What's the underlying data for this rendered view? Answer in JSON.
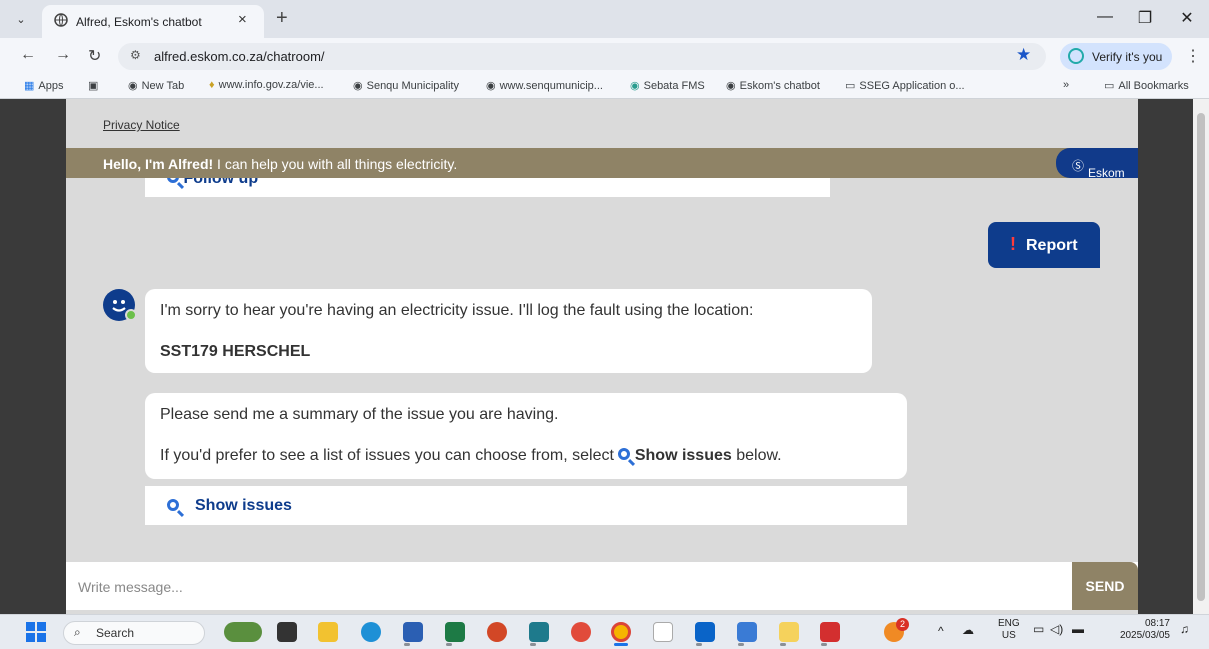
{
  "browser": {
    "tab_title": "Alfred, Eskom's chatbot",
    "tab_close": "×",
    "new_tab": "+",
    "url": "alfred.eskom.co.za/chatroom/",
    "verify_label": "Verify it's you",
    "window_minimize": "—",
    "window_restore": "❐",
    "window_close": "✕"
  },
  "bookmarks": {
    "apps": "Apps",
    "items": [
      "New Tab",
      "www.info.gov.za/vie...",
      "Senqu Municipality",
      "www.senqumunicip...",
      "Sebata FMS",
      "Eskom's chatbot",
      "SSEG Application o..."
    ],
    "more": "»",
    "all_bookmarks": "All Bookmarks"
  },
  "chat": {
    "privacy_notice": "Privacy Notice",
    "hello_bold": "Hello, I'm Alfred!",
    "hello_rest": " I can help you with all things electricity.",
    "brand": "Eskom",
    "follow_up": "Follow up",
    "report_label": "Report",
    "message1_line1": "I'm sorry to hear you're having an electricity issue. I'll log the fault using the location:",
    "message1_location": "SST179 HERSCHEL",
    "message2_line1": "Please send me a summary of the issue you are having.",
    "message2_line2_prefix": "If you'd prefer to see a list of issues you can choose from, select ",
    "message2_line2_bold": "Show issues",
    "message2_line2_suffix": " below.",
    "show_issues": "Show issues",
    "compose_placeholder": "Write message...",
    "send_label": "SEND"
  },
  "taskbar": {
    "search_label": "Search",
    "notification_count": "2",
    "lang_top": "ENG",
    "lang_bottom": "US",
    "time": "08:17",
    "date": "2025/03/05"
  },
  "colors": {
    "eskom_blue": "#0e3c8c",
    "header_taupe": "#8f8366",
    "chat_bg": "#dadada"
  }
}
